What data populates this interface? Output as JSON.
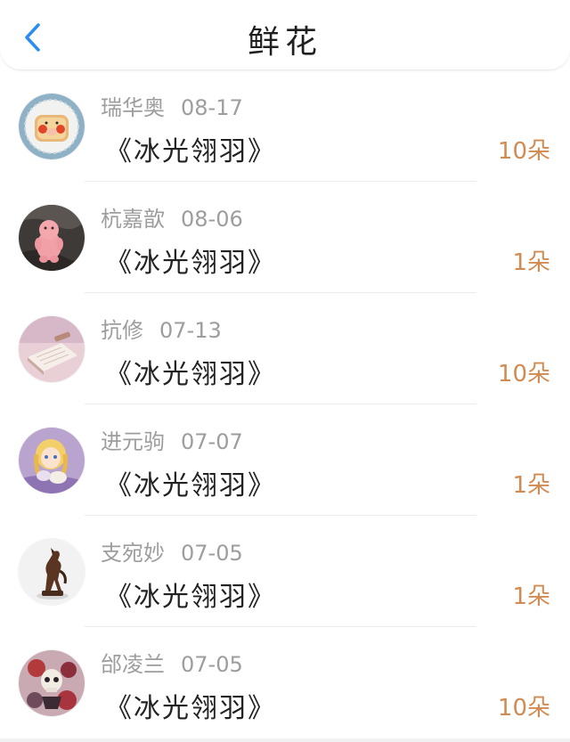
{
  "header": {
    "title": "鲜花",
    "back_icon": "chevron-left-icon",
    "accent_color": "#2d8cf0"
  },
  "colors": {
    "count": "#d18b52",
    "meta": "#9d9d9d"
  },
  "items": [
    {
      "name": "瑞华奥",
      "date": "08-17",
      "book": "《冰光翎羽》",
      "count": "10朵",
      "avatar": "toast-pig-avatar"
    },
    {
      "name": "杭嘉歆",
      "date": "08-06",
      "book": "《冰光翎羽》",
      "count": "1朵",
      "avatar": "pink-toy-avatar"
    },
    {
      "name": "抗修",
      "date": "07-13",
      "book": "《冰光翎羽》",
      "count": "10朵",
      "avatar": "notebook-avatar"
    },
    {
      "name": "进元驹",
      "date": "07-07",
      "book": "《冰光翎羽》",
      "count": "1朵",
      "avatar": "anime-girl-avatar"
    },
    {
      "name": "支宛妙",
      "date": "07-05",
      "book": "《冰光翎羽》",
      "count": "1朵",
      "avatar": "horse-statue-avatar"
    },
    {
      "name": "邰凌兰",
      "date": "07-05",
      "book": "《冰光翎羽》",
      "count": "10朵",
      "avatar": "skull-art-avatar"
    }
  ]
}
